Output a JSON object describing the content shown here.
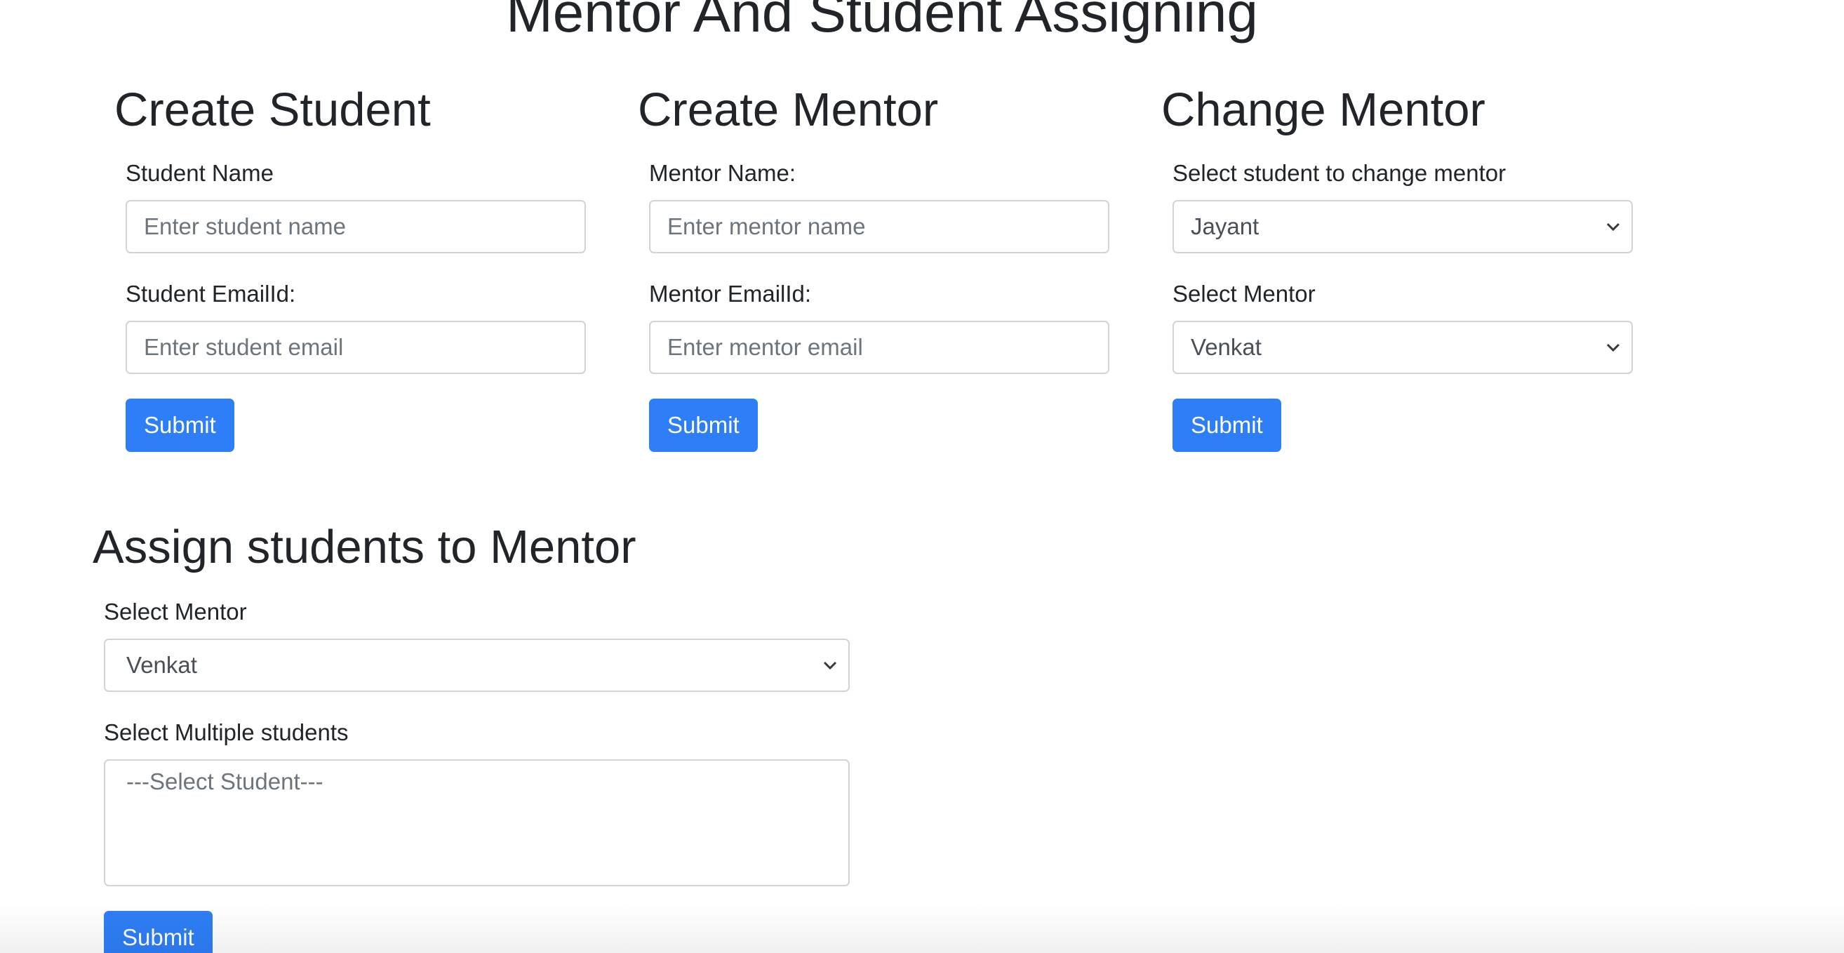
{
  "page": {
    "title": "Mentor And Student Assigning"
  },
  "create_student": {
    "heading": "Create Student",
    "name_label": "Student Name",
    "name_placeholder": "Enter student name",
    "email_label": "Student EmailId:",
    "email_placeholder": "Enter student email",
    "submit_label": "Submit"
  },
  "create_mentor": {
    "heading": "Create Mentor",
    "name_label": "Mentor Name:",
    "name_placeholder": "Enter mentor name",
    "email_label": "Mentor EmailId:",
    "email_placeholder": "Enter mentor email",
    "submit_label": "Submit"
  },
  "change_mentor": {
    "heading": "Change Mentor",
    "student_label": "Select student to change mentor",
    "student_selected": "Jayant",
    "mentor_label": "Select Mentor",
    "mentor_selected": "Venkat",
    "submit_label": "Submit"
  },
  "assign_students": {
    "heading": "Assign students to Mentor",
    "mentor_label": "Select Mentor",
    "mentor_selected": "Venkat",
    "students_label": "Select Multiple students",
    "students_options": [
      "---Select Student---"
    ],
    "submit_label": "Submit"
  },
  "colors": {
    "primary": "#2e7ef7",
    "border": "#ced4da",
    "text": "#212529",
    "placeholder": "#6c757d"
  }
}
